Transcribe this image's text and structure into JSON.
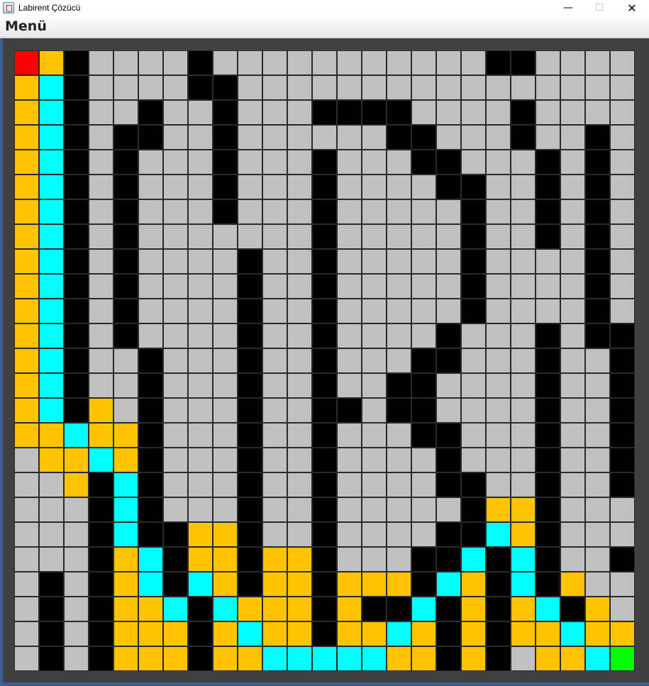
{
  "window": {
    "title": "Labirent Çözücü",
    "minimize_symbol": "—",
    "maximize_symbol": "☐",
    "close_symbol": "✕"
  },
  "menu": {
    "label": "Menü"
  },
  "legend_colors": {
    "W": "#000000",
    "E": "#c0c0c0",
    "P": "#ffc400",
    "C": "#00ffff",
    "S": "#ff0000",
    "G": "#00ff00"
  },
  "maze": {
    "rows": 25,
    "cols": 25,
    "grid": [
      "SPWEEEEWEEEEEEEEEEEWWEEEE",
      "PCWEEEEWWEEEEEEEEEEEEEEEE",
      "PCWEEWEEWEEEWWWWEEEEWEEEE",
      "PCWEWWEEWEEEEEEWWEEEWEEWE",
      "PCWEWEEEWEEEWEEEWWEEEWEWE",
      "PCWEWEEEWEEEWEEEEWWEEWEWE",
      "PCWEWEEEWEEEWEEEEEWEEWEWE",
      "PCWEWEEEEEEEWEEEEEWEEWEWE",
      "PCWEWEEEEWEEWEEEEEWEEEEWE",
      "PCWEWEEEEWEEWEEEEEWEEEEWE",
      "PCWEWEEEEWEEWEEEEEWEEEEWE",
      "PCWEWEEEEWEEWEEEEWEEEWEWW",
      "PCWEEWEEEWEEWEEEWWEEEWEEW",
      "PCWEEWEEEWEEWEEWWEEEEWEEW",
      "PCWPEWEEEWEEWWEWWEEEEWEEW",
      "PPCPPWEEEWEEWEEEWWEEEWEEW",
      "EPPCPWEEEWEEWEEEEWEEEWEEW",
      "EEPWCWEEEWEEWEEEEWWEEWEEW",
      "EEEWCWEEEWEEWEEEEEWPPWEEE",
      "EEEWCWWPPWEEWEEEEWWCPWEEE",
      "EEEWPCWPPWPPWEEEWWCWCWEEW",
      "EWEWPCWCPWPPWPPPWCPWCWPEE",
      "EWEWPPCWCPPPWPWWCWPWPCWPE",
      "EWEWPPPWPCPPWPPCPWPWPPCPP",
      "EWEWPPPWPPCCCCCPPWPWEPPCG"
    ]
  }
}
